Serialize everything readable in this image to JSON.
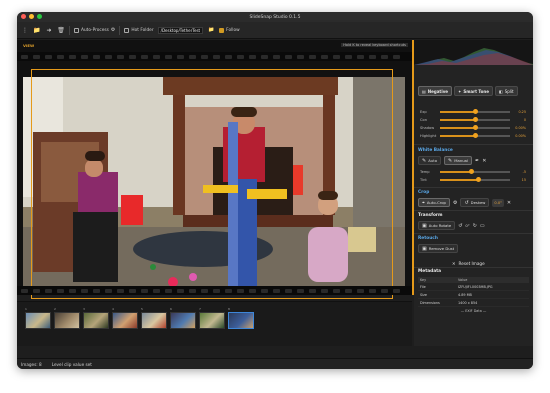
{
  "window": {
    "title": "SlideSnap Studio 0.1.5"
  },
  "colors": {
    "accent": "#e59a1a",
    "blue_section": "#5aa8e8",
    "selected_thumb": "#3d86d9"
  },
  "toolbar": {
    "auto_process_label": "Auto-Process",
    "hot_folder_label": "Hot Folder",
    "hot_folder_path": "/Desktop/TetherTest",
    "follow_label": "Follow"
  },
  "viewer": {
    "zoom_label": "VIEW",
    "hint": "Hold K to reveal keyboard shortcuts"
  },
  "panel": {
    "modes": {
      "negative": "Negative",
      "smart_tone": "Smart Tone",
      "split": "Split"
    },
    "tone_sliders": [
      {
        "label": "Exp",
        "value": "0.25",
        "level": 0.5
      },
      {
        "label": "Con",
        "value": "0",
        "level": 0.5
      },
      {
        "label": "Shadow",
        "value": "0.00%",
        "level": 0.5
      },
      {
        "label": "Highlight",
        "value": "0.00%",
        "level": 0.5
      }
    ],
    "white_balance_title": "White Balance",
    "wb_auto": "Auto",
    "wb_manual": "Manual",
    "wb_sliders": [
      {
        "label": "Temp",
        "value": "-5",
        "level": 0.45
      },
      {
        "label": "Tint",
        "value": "15",
        "level": 0.55
      }
    ],
    "crop_title": "Crop",
    "crop_auto": "Auto-Crop",
    "crop_deskew": "Deskew",
    "crop_value": "0.0°",
    "transform_title": "Transform",
    "auto_rotate": "Auto Rotate",
    "rotate_value": "0°",
    "retouch_title": "Retouch",
    "remove_dust": "Remove Dust",
    "reset_image": "Reset Image",
    "metadata_title": "Metadata",
    "meta_headers": [
      "Key",
      "Value"
    ],
    "meta_rows": [
      [
        "File",
        "IZFUJIFI-0003MB.JPG"
      ],
      [
        "Size",
        "4.89 MB"
      ],
      [
        "Dimensions",
        "1400 x 854"
      ]
    ],
    "exif_toggle": "— EXIF Data —"
  },
  "thumbnails": [
    {
      "num": "1",
      "tag": ""
    },
    {
      "num": "2",
      "tag": ""
    },
    {
      "num": "3",
      "tag": ""
    },
    {
      "num": "4",
      "tag": ""
    },
    {
      "num": "5",
      "tag": ""
    },
    {
      "num": "6",
      "tag": ""
    },
    {
      "num": "7",
      "tag": ""
    },
    {
      "num": "8",
      "tag": ""
    }
  ],
  "status": {
    "images_count": "Images: 8",
    "message": "Level clip value set"
  }
}
